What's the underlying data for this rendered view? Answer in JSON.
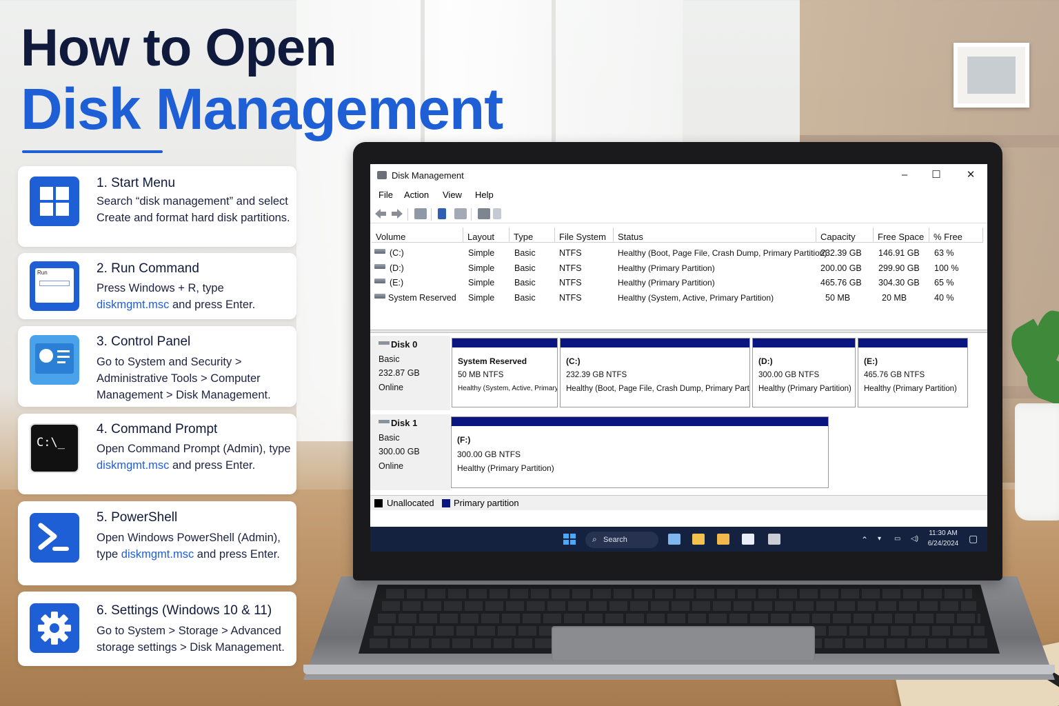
{
  "hero": {
    "title_line1": "How to Open",
    "title_line2": "Disk Management"
  },
  "methods": [
    {
      "title": "1. Start Menu",
      "icon": "windows-logo-icon",
      "body_pre": "Search “disk management” and select Create and format hard disk partitions.",
      "highlight": "",
      "body_post": ""
    },
    {
      "title": "2. Run Command",
      "icon": "run-dialog-icon",
      "run_label": "Run",
      "body_pre": "Press Windows + R, type ",
      "highlight": "diskmgmt.msc",
      "body_post": " and press Enter."
    },
    {
      "title": "3. Control Panel",
      "icon": "control-panel-icon",
      "body_pre": "Go to System and Security > Administrative Tools > Computer Management > Disk Management.",
      "highlight": "",
      "body_post": ""
    },
    {
      "title": "4. Command Prompt",
      "icon": "command-prompt-icon",
      "prompt_text": "C:\\_",
      "body_pre": "Open Command Prompt (Admin), type ",
      "highlight": "diskmgmt.msc",
      "body_post": " and press Enter."
    },
    {
      "title": "5. PowerShell",
      "icon": "powershell-icon",
      "body_pre": "Open Windows PowerShell (Admin), type ",
      "highlight": "diskmgmt.msc",
      "body_post": " and press Enter."
    },
    {
      "title": "6. Settings (Windows 10 & 11)",
      "icon": "gear-icon",
      "body_pre": "Go to System > Storage > Advanced storage settings > Disk Management.",
      "highlight": "",
      "body_post": ""
    }
  ],
  "window": {
    "title": "Disk Management",
    "controls": {
      "minimize": "–",
      "maximize": "☐",
      "close": "✕"
    },
    "menu": [
      "File",
      "Action",
      "View",
      "Help"
    ],
    "columns": [
      "Volume",
      "Layout",
      "Type",
      "File System",
      "Status",
      "Capacity",
      "Free Space",
      "% Free"
    ],
    "volumes": [
      [
        "(C:)",
        "Simple",
        "Basic",
        "NTFS",
        "Healthy (Boot, Page File, Crash Dump, Primary Partition)",
        "232.39 GB",
        "146.91 GB",
        "63 %"
      ],
      [
        "(D:)",
        "Simple",
        "Basic",
        "NTFS",
        "Healthy (Primary Partition)",
        "200.00 GB",
        "299.90 GB",
        "100 %"
      ],
      [
        "(E:)",
        "Simple",
        "Basic",
        "NTFS",
        "Healthy (Primary Partition)",
        "465.76 GB",
        "304.30 GB",
        "65 %"
      ],
      [
        "System Reserved",
        "Simple",
        "Basic",
        "NTFS",
        "Healthy (System, Active, Primary Partition)",
        "50 MB",
        "20 MB",
        "40 %"
      ]
    ],
    "disks": [
      {
        "name": "Disk 0",
        "type": "Basic",
        "size": "232.87 GB",
        "state": "Online",
        "partitions": [
          {
            "name": "System Reserved",
            "size": "50 MB NTFS",
            "status": "Healthy (System, Active, Primary Partition)"
          },
          {
            "name": "(C:)",
            "size": "232.39 GB NTFS",
            "status": "Healthy (Boot, Page File, Crash Dump, Primary Partition)"
          },
          {
            "name": "(D:)",
            "size": "300.00 GB NTFS",
            "status": "Healthy (Primary Partition)"
          },
          {
            "name": "(E:)",
            "size": "465.76 GB NTFS",
            "status": "Healthy (Primary Partition)"
          }
        ]
      },
      {
        "name": "Disk 1",
        "type": "Basic",
        "size": "300.00 GB",
        "state": "Online",
        "partitions": [
          {
            "name": "(F:)",
            "size": "300.00 GB NTFS",
            "status": "Healthy (Primary Partition)"
          }
        ]
      }
    ],
    "legend": [
      {
        "label": "Unallocated",
        "color": "#000000"
      },
      {
        "label": "Primary partition",
        "color": "#0b1580"
      }
    ]
  },
  "taskbar": {
    "search_placeholder": "Search",
    "time": "11:30 AM",
    "date": "6/24/2024"
  },
  "colors": {
    "accent": "#1f5fd6",
    "heading": "#0f1a3d",
    "partition_bar": "#0b1580",
    "taskbar": "#14213f"
  }
}
